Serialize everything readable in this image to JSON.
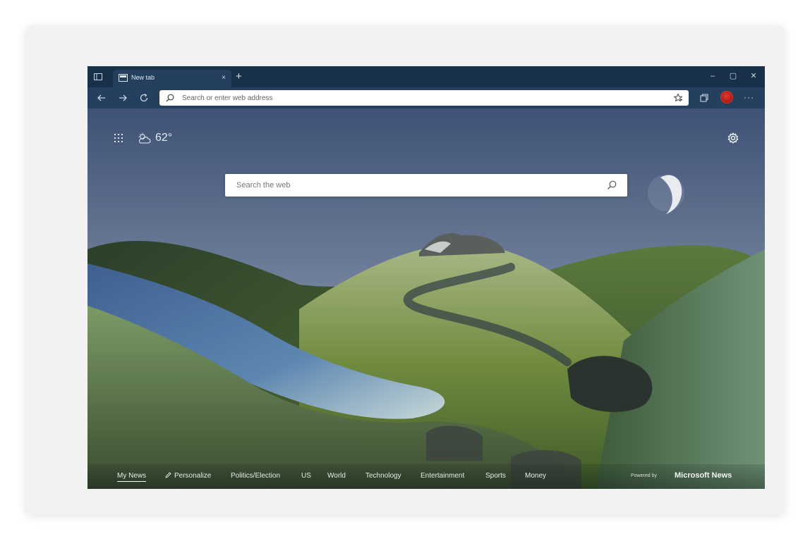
{
  "tab": {
    "title": "New tab",
    "close": "×",
    "new_tab": "+"
  },
  "window_controls": {
    "minimize": "–",
    "maximize": "▢",
    "close": "✕"
  },
  "addressbar": {
    "placeholder": "Search or enter web address"
  },
  "toolbar": {
    "more": "···",
    "icons": [
      "back-arrow-icon",
      "forward-arrow-icon",
      "refresh-icon",
      "favorite-star-icon",
      "collections-icon"
    ]
  },
  "newtab": {
    "weather_temp": "62°",
    "search_placeholder": "Search the web"
  },
  "newsbar": {
    "items": [
      "My News",
      "Personalize",
      "Politics/Election",
      "US",
      "World",
      "Technology",
      "Entertainment",
      "Sports",
      "Money"
    ],
    "active": "My News",
    "powered_by": "Powered by",
    "brand": "Microsoft News"
  },
  "colors": {
    "titlebar": "#18304a",
    "toolbar": "#25405f",
    "sky_top": "#4b5a7a",
    "sky_bottom": "#8d9bb0",
    "hill_green": "#4f6b2e",
    "river_blue": "#4a6e9c",
    "avatar_red": "#d7342a"
  }
}
